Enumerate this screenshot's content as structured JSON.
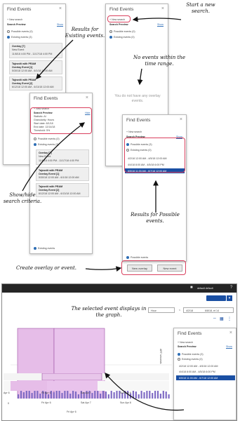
{
  "annotations": {
    "results_existing": "Results for\nExisting events.",
    "start_new": "Start a new\nsearch.",
    "no_events": "No events within the\ntime range.",
    "show_hide": "Show/hide\nsearch criteria.",
    "results_possible": "Results for Possible\nevents.",
    "create": "Create overlay or event.",
    "selected_graph": "The selected event displays in\nthe graph."
  },
  "panel_common": {
    "title": "Find Events",
    "close_glyph": "×",
    "new_search": "+ New search",
    "search_preview": "Search Preview",
    "show": "Show",
    "hide": "Hide",
    "possible_events": "Possible events (3)",
    "possible_events_0": "Possible events (0)",
    "existing_events": "Existing events (3)",
    "existing_events_0": "Existing events (0)",
    "existing_footer": "Existing events",
    "possible_footer": "Possible events"
  },
  "existing_cards": [
    {
      "title": "Overlay [7]",
      "sub": "New Event",
      "range": "11/8/18 4:00 PM - 11/17/18 4:00 PM"
    },
    {
      "title": "Tajeoviti with PRAM",
      "sub": "Overlay Event [1]",
      "range": "5/30/18 12:00 AM - 6/1/18 12:00 AM"
    },
    {
      "title": "Tajeoviti with PRAM",
      "sub": "Overlay Event [2]",
      "range": "6/12/18 12:00 AM - 6/13/18 12:00 AM"
    }
  ],
  "criteria": {
    "statistic": "Statistic: Al",
    "granularity": "Granularity: Hours",
    "start": "Start date: 8/1/18",
    "end": "End date: 12/14/18",
    "threshold": "Threshold: 5%"
  },
  "empty_message": "You do not have any overlay events.",
  "possible_rows": [
    "4/2/18 12:00 AM - 4/5/18 12:00 AM",
    "4/4/18 8:00 AM - 4/5/18 6:00 PM",
    "6/5/18 11:00 AM - 6/7/18 12:00 AM"
  ],
  "buttons": {
    "new_overlay": "New overlay",
    "new_event": "New event"
  },
  "app": {
    "user": "default default",
    "save": "Save",
    "view": "Hour",
    "date_from": "4/2/18",
    "date_to": "6/8/18, et 14",
    "y_axis": "ART seconds",
    "x_ticks": [
      "Fri Apr 6",
      "Sat Apr 7",
      "Sun Apr 8"
    ],
    "mini_ticks": [
      "Apr 6",
      "Fri Apr 6",
      "Sat Apr 7",
      "Sun Apr 8"
    ],
    "bottom_tick": "Fri Apr 6",
    "zero": "0"
  }
}
